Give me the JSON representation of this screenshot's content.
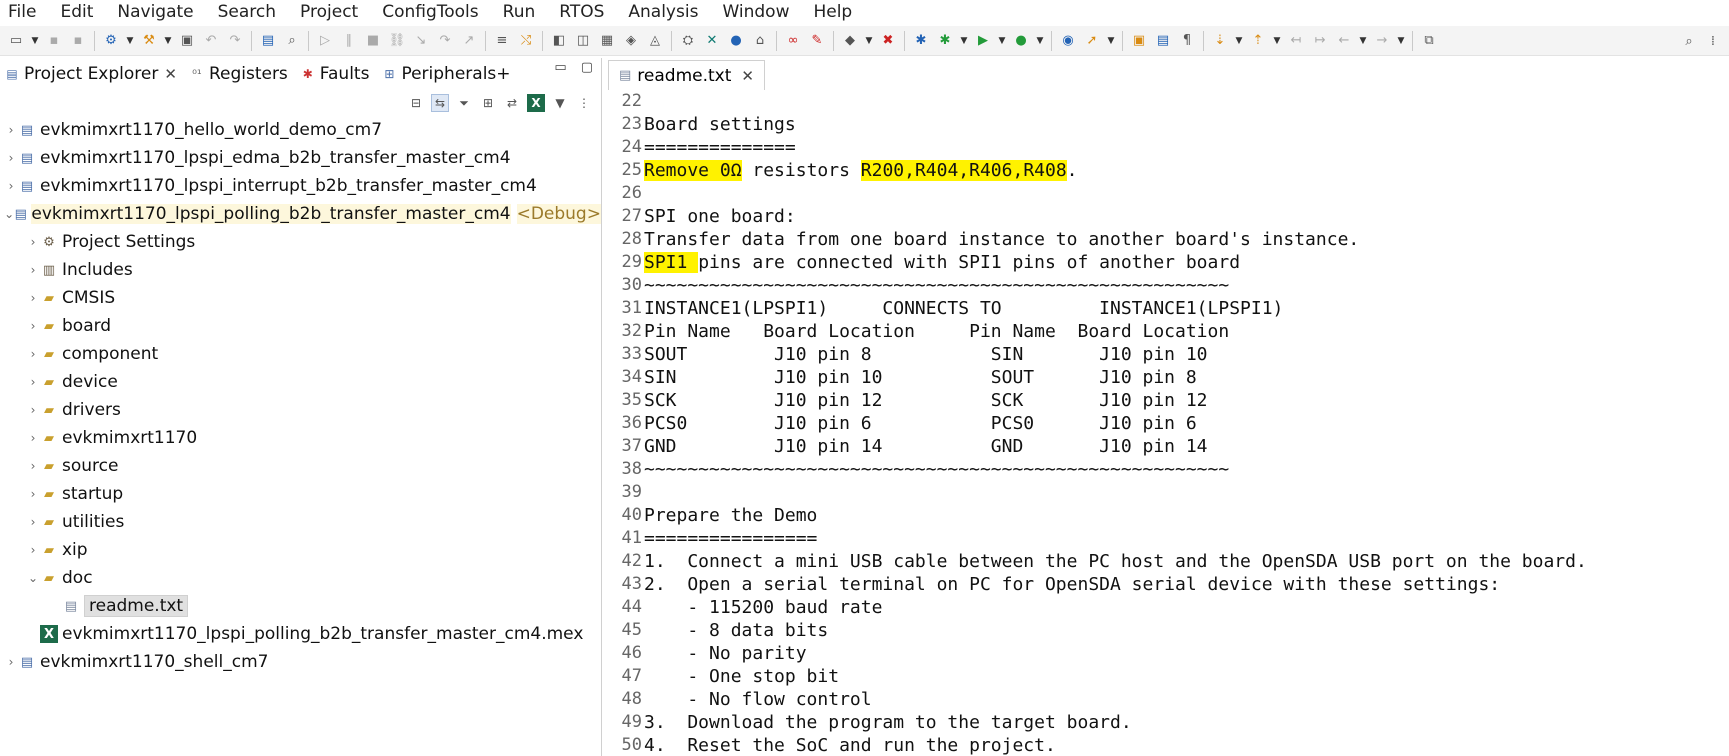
{
  "menubar": {
    "items": [
      "File",
      "Edit",
      "Navigate",
      "Search",
      "Project",
      "ConfigTools",
      "Run",
      "RTOS",
      "Analysis",
      "Window",
      "Help"
    ]
  },
  "left_view": {
    "tabs": [
      {
        "label": "Project Explorer",
        "icon": "project-explorer-icon",
        "closable": true
      },
      {
        "label": "Registers",
        "icon": "registers-icon"
      },
      {
        "label": "Faults",
        "icon": "faults-icon"
      },
      {
        "label": "Peripherals+",
        "icon": "peripherals-icon"
      }
    ]
  },
  "tree": {
    "items": [
      {
        "label": "evkmimxrt1170_hello_world_demo_cm7",
        "level": 0,
        "expanded": false,
        "icon": "project-icon"
      },
      {
        "label": "evkmimxrt1170_lpspi_edma_b2b_transfer_master_cm4",
        "level": 0,
        "expanded": false,
        "icon": "project-icon"
      },
      {
        "label": "evkmimxrt1170_lpspi_interrupt_b2b_transfer_master_cm4",
        "level": 0,
        "expanded": false,
        "icon": "project-icon"
      },
      {
        "label": "evkmimxrt1170_lpspi_polling_b2b_transfer_master_cm4",
        "decor": "<Debug>",
        "level": 0,
        "expanded": true,
        "icon": "project-icon",
        "highlight": true
      },
      {
        "label": "Project Settings",
        "level": 1,
        "expanded": false,
        "icon": "settings-icon"
      },
      {
        "label": "Includes",
        "level": 1,
        "expanded": false,
        "icon": "includes-icon"
      },
      {
        "label": "CMSIS",
        "level": 1,
        "expanded": false,
        "icon": "folder-icon"
      },
      {
        "label": "board",
        "level": 1,
        "expanded": false,
        "icon": "folder-icon"
      },
      {
        "label": "component",
        "level": 1,
        "expanded": false,
        "icon": "folder-icon"
      },
      {
        "label": "device",
        "level": 1,
        "expanded": false,
        "icon": "folder-icon"
      },
      {
        "label": "drivers",
        "level": 1,
        "expanded": false,
        "icon": "folder-icon"
      },
      {
        "label": "evkmimxrt1170",
        "level": 1,
        "expanded": false,
        "icon": "folder-icon"
      },
      {
        "label": "source",
        "level": 1,
        "expanded": false,
        "icon": "folder-icon"
      },
      {
        "label": "startup",
        "level": 1,
        "expanded": false,
        "icon": "folder-icon"
      },
      {
        "label": "utilities",
        "level": 1,
        "expanded": false,
        "icon": "folder-icon"
      },
      {
        "label": "xip",
        "level": 1,
        "expanded": false,
        "icon": "folder-icon"
      },
      {
        "label": "doc",
        "level": 1,
        "expanded": true,
        "icon": "folder-icon"
      },
      {
        "label": "readme.txt",
        "level": 2,
        "expanded": null,
        "icon": "text-file-icon",
        "selected": true
      },
      {
        "label": "evkmimxrt1170_lpspi_polling_b2b_transfer_master_cm4.mex",
        "level": 1,
        "expanded": null,
        "icon": "mex-file-icon"
      },
      {
        "label": "evkmimxrt1170_shell_cm7",
        "level": 0,
        "expanded": false,
        "icon": "project-icon"
      }
    ]
  },
  "editor": {
    "tab_label": "readme.txt",
    "lines": [
      {
        "n": "22",
        "text": ""
      },
      {
        "n": "23",
        "text": "Board settings"
      },
      {
        "n": "24",
        "text": "=============="
      },
      {
        "n": "25",
        "segments": [
          {
            "t": "Remove 0Ω",
            "hl": true
          },
          {
            "t": " resistors ",
            "hl": false
          },
          {
            "t": "R200,R404,R406,R408",
            "hl": true
          },
          {
            "t": ".",
            "hl": false
          }
        ]
      },
      {
        "n": "26",
        "text": ""
      },
      {
        "n": "27",
        "text": "SPI one board:"
      },
      {
        "n": "28",
        "text": "Transfer data from one board instance to another board's instance."
      },
      {
        "n": "29",
        "segments": [
          {
            "t": "SPI1 ",
            "hl": true
          },
          {
            "t": "pins are connected with SPI1 pins of another board",
            "hl": false
          }
        ]
      },
      {
        "n": "30",
        "text": "~~~~~~~~~~~~~~~~~~~~~~~~~~~~~~~~~~~~~~~~~~~~~~~~~~~~~~"
      },
      {
        "n": "31",
        "text": "INSTANCE1(LPSPI1)     CONNECTS TO         INSTANCE1(LPSPI1)"
      },
      {
        "n": "32",
        "text": "Pin Name   Board Location     Pin Name  Board Location"
      },
      {
        "n": "33",
        "text": "SOUT        J10 pin 8           SIN       J10 pin 10"
      },
      {
        "n": "34",
        "text": "SIN         J10 pin 10          SOUT      J10 pin 8"
      },
      {
        "n": "35",
        "text": "SCK         J10 pin 12          SCK       J10 pin 12"
      },
      {
        "n": "36",
        "text": "PCS0        J10 pin 6           PCS0      J10 pin 6"
      },
      {
        "n": "37",
        "text": "GND         J10 pin 14          GND       J10 pin 14"
      },
      {
        "n": "38",
        "text": "~~~~~~~~~~~~~~~~~~~~~~~~~~~~~~~~~~~~~~~~~~~~~~~~~~~~~~"
      },
      {
        "n": "39",
        "text": ""
      },
      {
        "n": "40",
        "text": "Prepare the Demo"
      },
      {
        "n": "41",
        "text": "================"
      },
      {
        "n": "42",
        "text": "1.  Connect a mini USB cable between the PC host and the OpenSDA USB port on the board."
      },
      {
        "n": "43",
        "text": "2.  Open a serial terminal on PC for OpenSDA serial device with these settings:"
      },
      {
        "n": "44",
        "text": "    - 115200 baud rate"
      },
      {
        "n": "45",
        "text": "    - 8 data bits"
      },
      {
        "n": "46",
        "text": "    - No parity"
      },
      {
        "n": "47",
        "text": "    - One stop bit"
      },
      {
        "n": "48",
        "text": "    - No flow control"
      },
      {
        "n": "49",
        "text": "3.  Download the program to the target board."
      },
      {
        "n": "50",
        "text": "4.  Reset the SoC and run the project."
      }
    ],
    "highlight_color": "#fff200"
  }
}
